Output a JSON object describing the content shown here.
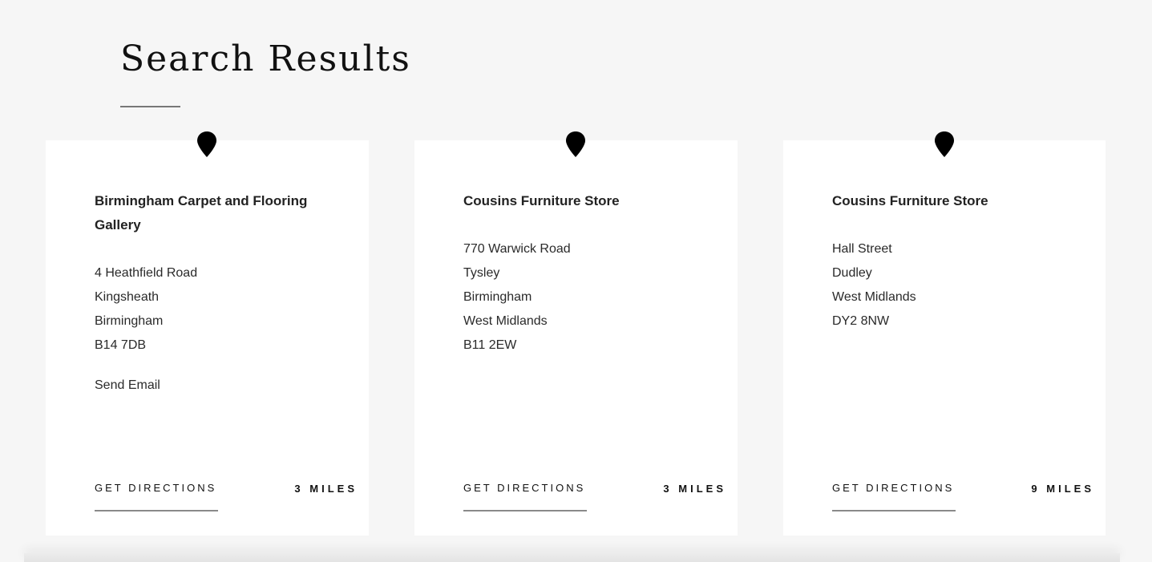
{
  "page": {
    "title": "Search Results"
  },
  "colors": {
    "background": "#f6f6f6",
    "card": "#ffffff",
    "text": "#1b1b1b",
    "rule": "#8a8a8a"
  },
  "results": [
    {
      "name": "Birmingham Carpet and Flooring Gallery",
      "address": [
        "4 Heathfield Road",
        "Kingsheath",
        "Birmingham",
        "B14 7DB"
      ],
      "email_label": "Send Email",
      "directions_label": "GET DIRECTIONS",
      "distance": "3 MILES",
      "icon": "map-pin-icon"
    },
    {
      "name": "Cousins Furniture Store",
      "address": [
        "770 Warwick Road",
        "Tysley",
        "Birmingham",
        "West Midlands",
        "B11 2EW"
      ],
      "directions_label": "GET DIRECTIONS",
      "distance": "3 MILES",
      "icon": "map-pin-icon"
    },
    {
      "name": "Cousins Furniture Store",
      "address": [
        "Hall Street",
        "Dudley",
        "West Midlands",
        "DY2 8NW"
      ],
      "directions_label": "GET DIRECTIONS",
      "distance": "9 MILES",
      "icon": "map-pin-icon"
    }
  ]
}
